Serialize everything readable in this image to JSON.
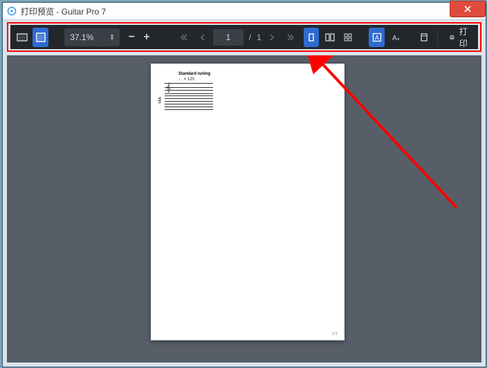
{
  "window": {
    "title": "打印预览 - Guitar Pro 7"
  },
  "toolbar": {
    "zoom_text": "37.1%",
    "page_current": "1",
    "page_total": "1",
    "print_label": "打印"
  },
  "document": {
    "song_title": "Standard tuning",
    "tempo": "= 120",
    "tab_label": "TAB",
    "page_number": "1/1"
  }
}
